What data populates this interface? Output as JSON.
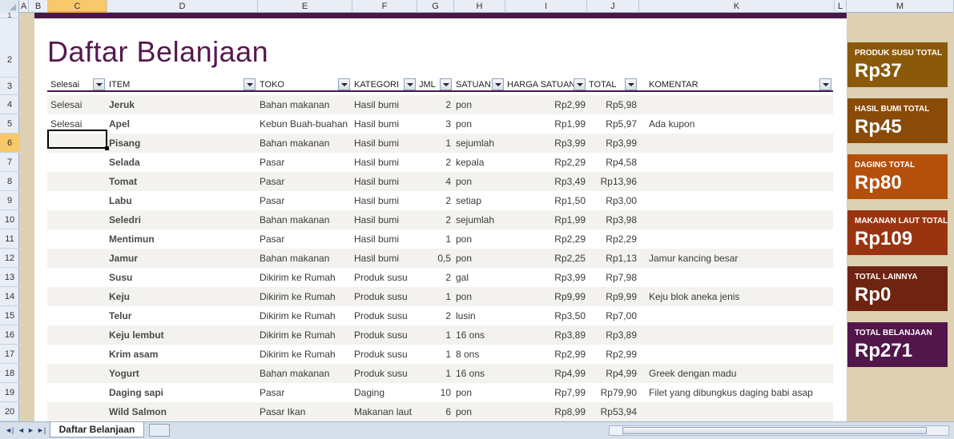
{
  "columns": [
    "A",
    "B",
    "C",
    "D",
    "E",
    "F",
    "G",
    "H",
    "I",
    "J",
    "K",
    "L",
    "M"
  ],
  "selected_column": "C",
  "rows": [
    "1",
    "2",
    "3",
    "4",
    "5",
    "6",
    "7",
    "8",
    "9",
    "10",
    "11",
    "12",
    "13",
    "14",
    "15",
    "16",
    "17",
    "18",
    "19",
    "20"
  ],
  "selected_row": "6",
  "title": "Daftar Belanjaan",
  "headers": {
    "selesai": "Selesai",
    "item": "ITEM",
    "toko": "TOKO",
    "kategori": "KATEGORI",
    "jml": "JML",
    "satuan": "SATUAN",
    "harga": "HARGA SATUAN",
    "total": "TOTAL",
    "komentar": "KOMENTAR"
  },
  "items": [
    {
      "selesai": "Selesai",
      "item": "Jeruk",
      "toko": "Bahan makanan",
      "kategori": "Hasil bumi",
      "jml": "2",
      "satuan": "pon",
      "harga": "Rp2,99",
      "total": "Rp5,98",
      "komentar": ""
    },
    {
      "selesai": "Selesai",
      "item": "Apel",
      "toko": "Kebun Buah-buahan",
      "kategori": "Hasil bumi",
      "jml": "3",
      "satuan": "pon",
      "harga": "Rp1,99",
      "total": "Rp5,97",
      "komentar": "Ada kupon"
    },
    {
      "selesai": "",
      "item": "Pisang",
      "toko": "Bahan makanan",
      "kategori": "Hasil bumi",
      "jml": "1",
      "satuan": "sejumlah",
      "harga": "Rp3,99",
      "total": "Rp3,99",
      "komentar": ""
    },
    {
      "selesai": "",
      "item": "Selada",
      "toko": "Pasar",
      "kategori": "Hasil bumi",
      "jml": "2",
      "satuan": "kepala",
      "harga": "Rp2,29",
      "total": "Rp4,58",
      "komentar": ""
    },
    {
      "selesai": "",
      "item": "Tomat",
      "toko": "Pasar",
      "kategori": "Hasil bumi",
      "jml": "4",
      "satuan": "pon",
      "harga": "Rp3,49",
      "total": "Rp13,96",
      "komentar": ""
    },
    {
      "selesai": "",
      "item": "Labu",
      "toko": "Pasar",
      "kategori": "Hasil bumi",
      "jml": "2",
      "satuan": "setiap",
      "harga": "Rp1,50",
      "total": "Rp3,00",
      "komentar": ""
    },
    {
      "selesai": "",
      "item": "Seledri",
      "toko": "Bahan makanan",
      "kategori": "Hasil bumi",
      "jml": "2",
      "satuan": "sejumlah",
      "harga": "Rp1,99",
      "total": "Rp3,98",
      "komentar": ""
    },
    {
      "selesai": "",
      "item": "Mentimun",
      "toko": "Pasar",
      "kategori": "Hasil bumi",
      "jml": "1",
      "satuan": "pon",
      "harga": "Rp2,29",
      "total": "Rp2,29",
      "komentar": ""
    },
    {
      "selesai": "",
      "item": "Jamur",
      "toko": "Bahan makanan",
      "kategori": "Hasil bumi",
      "jml": "0,5",
      "satuan": "pon",
      "harga": "Rp2,25",
      "total": "Rp1,13",
      "komentar": "Jamur kancing besar"
    },
    {
      "selesai": "",
      "item": "Susu",
      "toko": "Dikirim ke Rumah",
      "kategori": "Produk susu",
      "jml": "2",
      "satuan": "gal",
      "harga": "Rp3,99",
      "total": "Rp7,98",
      "komentar": ""
    },
    {
      "selesai": "",
      "item": "Keju",
      "toko": "Dikirim ke Rumah",
      "kategori": "Produk susu",
      "jml": "1",
      "satuan": "pon",
      "harga": "Rp9,99",
      "total": "Rp9,99",
      "komentar": "Keju blok aneka jenis"
    },
    {
      "selesai": "",
      "item": "Telur",
      "toko": "Dikirim ke Rumah",
      "kategori": "Produk susu",
      "jml": "2",
      "satuan": "lusin",
      "harga": "Rp3,50",
      "total": "Rp7,00",
      "komentar": ""
    },
    {
      "selesai": "",
      "item": "Keju lembut",
      "toko": "Dikirim ke Rumah",
      "kategori": "Produk susu",
      "jml": "1",
      "satuan": "16 ons",
      "harga": "Rp3,89",
      "total": "Rp3,89",
      "komentar": ""
    },
    {
      "selesai": "",
      "item": "Krim asam",
      "toko": "Dikirim ke Rumah",
      "kategori": "Produk susu",
      "jml": "1",
      "satuan": "8 ons",
      "harga": "Rp2,99",
      "total": "Rp2,99",
      "komentar": ""
    },
    {
      "selesai": "",
      "item": "Yogurt",
      "toko": "Bahan makanan",
      "kategori": "Produk susu",
      "jml": "1",
      "satuan": "16 ons",
      "harga": "Rp4,99",
      "total": "Rp4,99",
      "komentar": "Greek dengan madu"
    },
    {
      "selesai": "",
      "item": "Daging sapi",
      "toko": "Pasar",
      "kategori": "Daging",
      "jml": "10",
      "satuan": "pon",
      "harga": "Rp7,99",
      "total": "Rp79,90",
      "komentar": "Filet yang dibungkus daging babi asap"
    },
    {
      "selesai": "",
      "item": "Wild Salmon",
      "toko": "Pasar Ikan",
      "kategori": "Makanan laut",
      "jml": "6",
      "satuan": "pon",
      "harga": "Rp8,99",
      "total": "Rp53,94",
      "komentar": ""
    }
  ],
  "summary": [
    {
      "label": "PRODUK SUSU TOTAL",
      "value": "Rp37",
      "color": "#8a5a0a"
    },
    {
      "label": "HASIL BUMI TOTAL",
      "value": "Rp45",
      "color": "#8a4a08"
    },
    {
      "label": "DAGING TOTAL",
      "value": "Rp80",
      "color": "#b4500c"
    },
    {
      "label": "MAKANAN LAUT TOTAL",
      "value": "Rp109",
      "color": "#9a3410"
    },
    {
      "label": "TOTAL LAINNYA",
      "value": "Rp0",
      "color": "#6e2410"
    },
    {
      "label": "TOTAL BELANJAAN",
      "value": "Rp271",
      "color": "#52164a"
    }
  ],
  "sheet_tab": "Daftar Belanjaan",
  "colors": {
    "accent": "#4a1848",
    "title": "#55184f",
    "tan": "#ddd0b3"
  }
}
